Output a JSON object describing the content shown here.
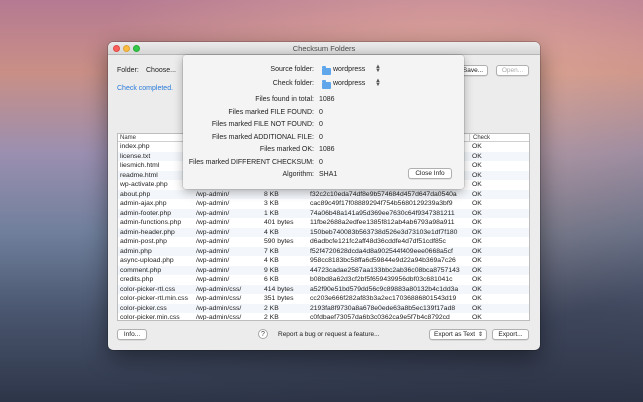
{
  "window": {
    "title": "Checksum Folders"
  },
  "toolbar": {
    "folder_label": "Folder:",
    "choose_button": "Choose...",
    "save_button": "Save...",
    "open_button": "Open..."
  },
  "status": "Check completed.",
  "table": {
    "columns": [
      "Name",
      "Check"
    ],
    "rows": [
      [
        "index.php",
        "",
        "",
        "",
        "OK"
      ],
      [
        "license.txt",
        "",
        "",
        "",
        "OK"
      ],
      [
        "liesmich.html",
        "",
        "",
        "",
        "OK"
      ],
      [
        "readme.html",
        "",
        "",
        "",
        "OK"
      ],
      [
        "wp-activate.php",
        "",
        "",
        "",
        "OK"
      ],
      [
        "about.php",
        "/wp-admin/",
        "8 KB",
        "f32c2c10eda74df8e9b574684d457d647da0540a",
        "OK"
      ],
      [
        "admin-ajax.php",
        "/wp-admin/",
        "3 KB",
        "cac89c49f17f08889294f754b5680129239a3bf9",
        "OK"
      ],
      [
        "admin-footer.php",
        "/wp-admin/",
        "1 KB",
        "74a06b48a141a95d369ee7630c64f9347381211",
        "OK"
      ],
      [
        "admin-functions.php",
        "/wp-admin/",
        "401 bytes",
        "11fbe2688a2edfee1385f812ab4ab6793a98a911",
        "OK"
      ],
      [
        "admin-header.php",
        "/wp-admin/",
        "4 KB",
        "150beb740083b563738d526e3d73103e1df7f180",
        "OK"
      ],
      [
        "admin-post.php",
        "/wp-admin/",
        "590 bytes",
        "d6adbcfe121fc2aff48d36cddfe4d7df51cdf85c",
        "OK"
      ],
      [
        "admin.php",
        "/wp-admin/",
        "7 KB",
        "f52f4720628dcda4d8a902544f409eee0668a5cf",
        "OK"
      ],
      [
        "async-upload.php",
        "/wp-admin/",
        "4 KB",
        "958cc8183bc58ffa6d59844e9d22a94b369a7c26",
        "OK"
      ],
      [
        "comment.php",
        "/wp-admin/",
        "9 KB",
        "44723cadae2587aa133bbc2ab36c08bca8757143",
        "OK"
      ],
      [
        "credits.php",
        "/wp-admin/",
        "6 KB",
        "b08bd8a62d3cf2bf5f659439956dbf03c681041c",
        "OK"
      ],
      [
        "color-picker-rtl.css",
        "/wp-admin/css/",
        "414 bytes",
        "a52f90e51bd579dd56c9c89883a80132b4c1dd3a",
        "OK"
      ],
      [
        "color-picker-rtl.min.css",
        "/wp-admin/css/",
        "351 bytes",
        "cc203e666f282af83b3a2ec17036886801543d19",
        "OK"
      ],
      [
        "color-picker.css",
        "/wp-admin/css/",
        "2 KB",
        "2193fa8f9730a8a678e0ede63a8b5ec139f17ad8",
        "OK"
      ],
      [
        "color-picker.min.css",
        "/wp-admin/css/",
        "2 KB",
        "c0fdbaef73057da6b3c0362ca9e5f7b4c8792cd",
        "OK"
      ]
    ]
  },
  "info": {
    "source_folder_label": "Source folder:",
    "source_folder_value": "wordpress",
    "check_folder_label": "Check folder:",
    "check_folder_value": "wordpress",
    "stats": [
      {
        "label": "Files found in total:",
        "value": "1086"
      },
      {
        "label": "Files marked FILE FOUND:",
        "value": "0"
      },
      {
        "label": "Files marked FILE NOT FOUND:",
        "value": "0"
      },
      {
        "label": "Files marked ADDITIONAL FILE:",
        "value": "0"
      },
      {
        "label": "Files marked OK:",
        "value": "1086"
      },
      {
        "label": "Files marked DIFFERENT CHECKSUM:",
        "value": "0"
      }
    ],
    "algorithm_label": "Algorithm:",
    "algorithm_value": "SHA1",
    "close_button": "Close Info"
  },
  "footer": {
    "info_button": "Info...",
    "help_icon": "?",
    "report_text": "Report a bug or request a feature...",
    "export_as_select": "Export as Text",
    "export_button": "Export..."
  },
  "colors": {
    "status_blue": "#2a7ad8",
    "folder_icon": "#5fa7ea"
  }
}
